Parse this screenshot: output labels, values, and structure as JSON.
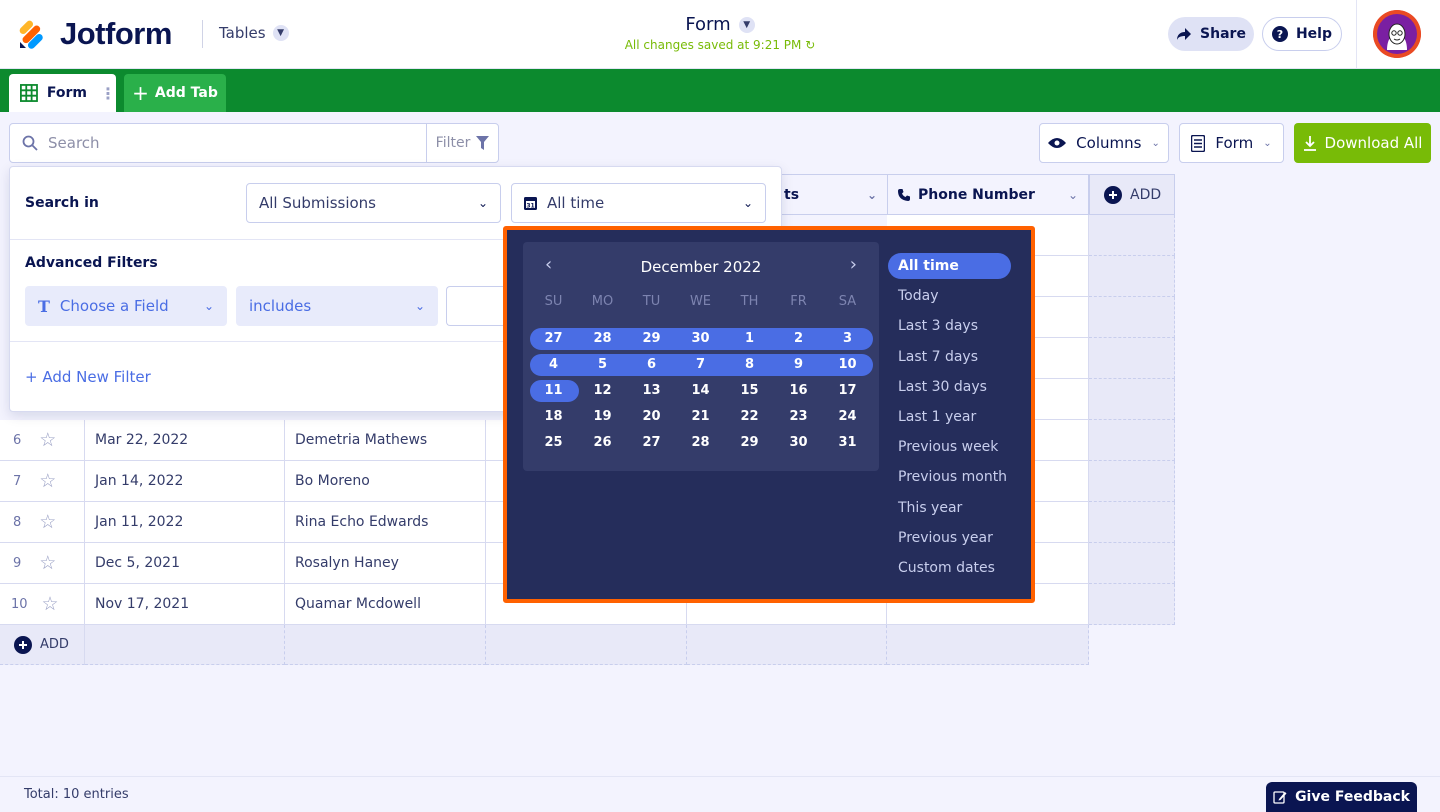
{
  "app": {
    "logo_text": "Jotform",
    "tables_label": "Tables",
    "form_title": "Form",
    "saved_status": "All changes saved at 9:21 PM",
    "share_label": "Share",
    "help_label": "Help"
  },
  "tabs": {
    "form_tab": "Form",
    "add_tab": "Add Tab"
  },
  "toolbar": {
    "search_placeholder": "Search",
    "filter_label": "Filter",
    "columns_label": "Columns",
    "form_label": "Form",
    "download_label": "Download All"
  },
  "table": {
    "headers": {
      "col4_partial": "ts",
      "phone": "Phone Number",
      "add_col": "ADD"
    },
    "rows": [
      {
        "num": "6",
        "date": "Mar 22, 2022",
        "name": "Demetria Mathews"
      },
      {
        "num": "7",
        "date": "Jan 14, 2022",
        "name": "Bo Moreno"
      },
      {
        "num": "8",
        "date": "Jan 11, 2022",
        "name": "Rina Echo Edwards"
      },
      {
        "num": "9",
        "date": "Dec 5, 2021",
        "name": "Rosalyn Haney"
      },
      {
        "num": "10",
        "date": "Nov 17, 2021",
        "name": "Quamar Mcdowell"
      }
    ],
    "add_row": "ADD"
  },
  "filter_panel": {
    "search_in_label": "Search in",
    "submissions_value": "All Submissions",
    "time_value": "All time",
    "advanced_label": "Advanced Filters",
    "field_value": "Choose a Field",
    "operator_value": "includes",
    "add_filter_label": "+ Add New Filter"
  },
  "calendar": {
    "month_label": "December 2022",
    "weekdays": [
      "SU",
      "MO",
      "TU",
      "WE",
      "TH",
      "FR",
      "SA"
    ],
    "weeks": [
      [
        "27",
        "28",
        "29",
        "30",
        "1",
        "2",
        "3"
      ],
      [
        "4",
        "5",
        "6",
        "7",
        "8",
        "9",
        "10"
      ],
      [
        "11",
        "12",
        "13",
        "14",
        "15",
        "16",
        "17"
      ],
      [
        "18",
        "19",
        "20",
        "21",
        "22",
        "23",
        "24"
      ],
      [
        "25",
        "26",
        "27",
        "28",
        "29",
        "30",
        "31"
      ]
    ],
    "presets": [
      "All time",
      "Today",
      "Last 3 days",
      "Last 7 days",
      "Last 30 days",
      "Last 1 year",
      "Previous week",
      "Previous month",
      "This year",
      "Previous year",
      "Custom dates"
    ],
    "active_preset": "All time"
  },
  "footer": {
    "total": "Total: 10 entries",
    "feedback": "Give Feedback"
  },
  "colors": {
    "brand_green": "#0c8a2e",
    "accent_orange": "#ff6100",
    "download_green": "#78bb07",
    "calendar_bg": "#252d5b",
    "selected_blue": "#4a6de4"
  }
}
